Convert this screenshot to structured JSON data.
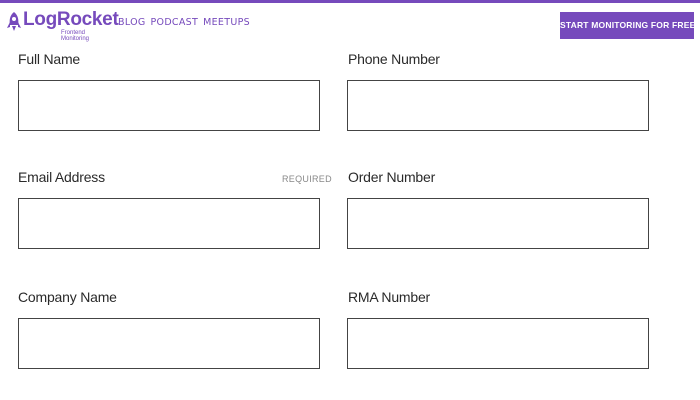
{
  "header": {
    "brand": "LogRocket",
    "tagline": "Frontend Monitoring",
    "nav": [
      "BLOG",
      "PODCAST",
      "MEETUPS"
    ],
    "cta_label": "START MONITORING FOR FREE",
    "accent_color": "#764abc",
    "logo_icon": "rocket-icon"
  },
  "form": {
    "full_name": {
      "label": "Full Name",
      "value": ""
    },
    "phone_number": {
      "label": "Phone Number",
      "value": ""
    },
    "email_address": {
      "label": "Email Address",
      "required": "REQUIRED",
      "value": ""
    },
    "order_number": {
      "label": "Order Number",
      "value": ""
    },
    "company_name": {
      "label": "Company Name",
      "value": ""
    },
    "rma_number": {
      "label": "RMA Number",
      "value": ""
    }
  }
}
